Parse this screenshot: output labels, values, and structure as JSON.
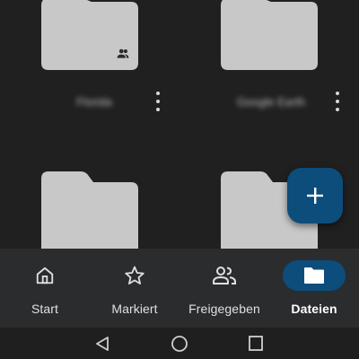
{
  "folders": [
    {
      "name": "Florida",
      "shared": true
    },
    {
      "name": "Google Earth",
      "shared": false
    },
    {
      "name": "",
      "shared": false
    },
    {
      "name": "",
      "shared": false
    }
  ],
  "icons": {
    "folder": "folder-icon",
    "shared": "people-icon",
    "more": "more-vert-icon",
    "fab": "plus-icon"
  },
  "bottom_nav": {
    "items": [
      {
        "label": "Start",
        "icon": "home-icon",
        "active": false
      },
      {
        "label": "Markiert",
        "icon": "star-icon",
        "active": false
      },
      {
        "label": "Freigegeben",
        "icon": "people-icon",
        "active": false
      },
      {
        "label": "Dateien",
        "icon": "folder-icon",
        "active": true
      }
    ]
  },
  "system_nav": {
    "buttons": [
      "back-icon",
      "home-circle-icon",
      "recents-icon"
    ]
  },
  "colors": {
    "background": "#202020",
    "folder": "#c8c8c8",
    "accent": "#0d4d7c",
    "nav_bar": "#2b2c2e"
  }
}
